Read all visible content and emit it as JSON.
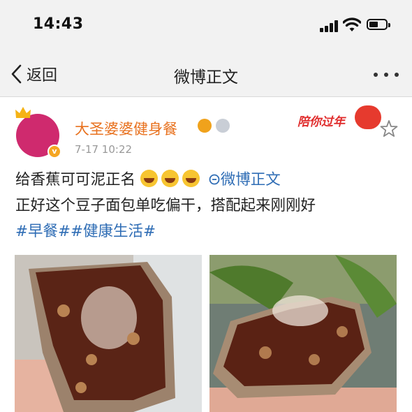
{
  "status": {
    "time": "14:43"
  },
  "nav": {
    "back_label": "返回",
    "title": "微博正文"
  },
  "post": {
    "username": "大圣婆婆健身餐",
    "timestamp": "7-17 10:22",
    "promo": "陪你过年",
    "line1": "给香蕉可可泥正名",
    "link_text": "微博正文",
    "line2": "正好这个豆子面包单吃偏干，搭配起来刚刚好",
    "hashtag1": "#早餐#",
    "hashtag2": "#健康生活#"
  },
  "colors": {
    "username": "#e8711e",
    "link": "#2f6db5",
    "avatar": "#cf2a6e",
    "verified_badge": "#f5a623"
  },
  "icons": [
    "back-chevron-icon",
    "more-dots-icon",
    "crown-icon",
    "verified-badge-icon",
    "vip-crown-badge-icon",
    "medal-badge-icon",
    "lantern-icon",
    "star-icon",
    "grin-emoji-icon",
    "link-icon"
  ]
}
